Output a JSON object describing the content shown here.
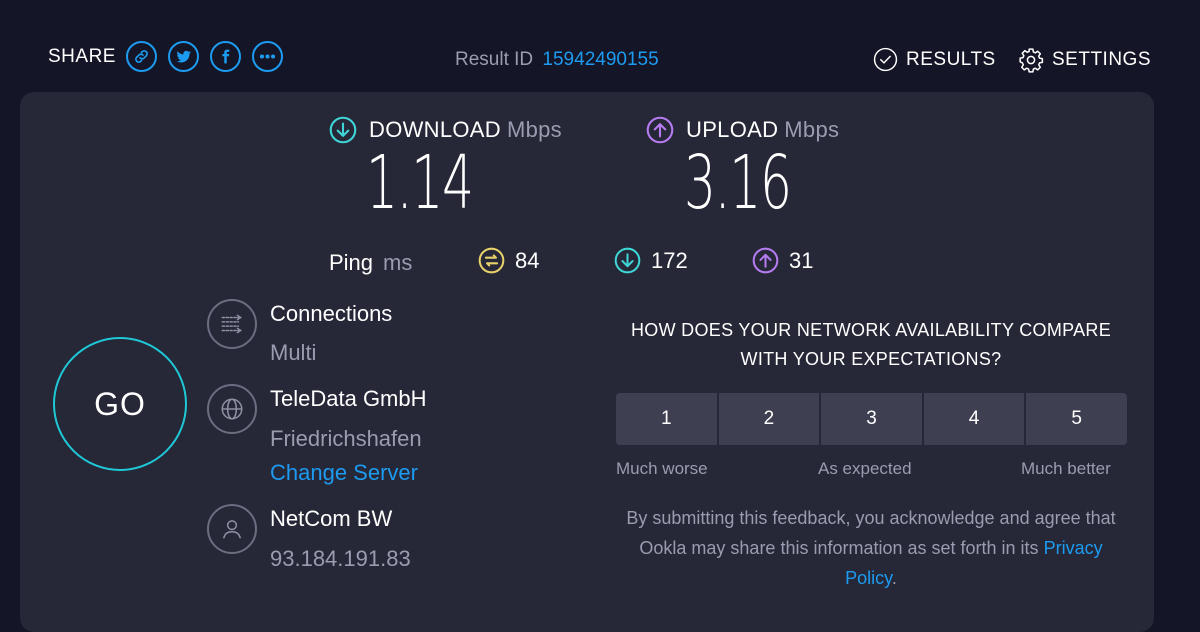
{
  "header": {
    "share_label": "SHARE",
    "share_buttons": [
      "link-icon",
      "twitter-icon",
      "facebook-icon",
      "more-icon"
    ],
    "result_id_label": "Result ID",
    "result_id": "15942490155",
    "results_label": "RESULTS",
    "settings_label": "SETTINGS"
  },
  "download": {
    "label": "DOWNLOAD",
    "unit": "Mbps",
    "value": "1.14",
    "color": "#3ed6d6"
  },
  "upload": {
    "label": "UPLOAD",
    "unit": "Mbps",
    "value": "3.16",
    "color": "#b57cf0"
  },
  "ping": {
    "label": "Ping",
    "unit": "ms",
    "idle": "84",
    "download": "172",
    "upload": "31",
    "idle_color": "#e8d26a"
  },
  "go_label": "GO",
  "connections": {
    "title": "Connections",
    "value": "Multi"
  },
  "server": {
    "name": "TeleData GmbH",
    "location": "Friedrichshafen",
    "change_label": "Change Server"
  },
  "isp": {
    "name": "NetCom BW",
    "ip": "93.184.191.83"
  },
  "survey": {
    "question": "HOW DOES YOUR NETWORK AVAILABILITY COMPARE WITH YOUR EXPECTATIONS?",
    "options": [
      "1",
      "2",
      "3",
      "4",
      "5"
    ],
    "low_label": "Much worse",
    "mid_label": "As expected",
    "high_label": "Much better",
    "disclaimer_text": "By submitting this feedback, you acknowledge and agree that Ookla may share this information as set forth in its",
    "privacy_link": "Privacy Policy",
    "disclaimer_end": "."
  },
  "colors": {
    "accent_blue": "#1c9bf0",
    "go_ring": "#1fc8d6",
    "background": "#141526",
    "card": "#262737"
  }
}
